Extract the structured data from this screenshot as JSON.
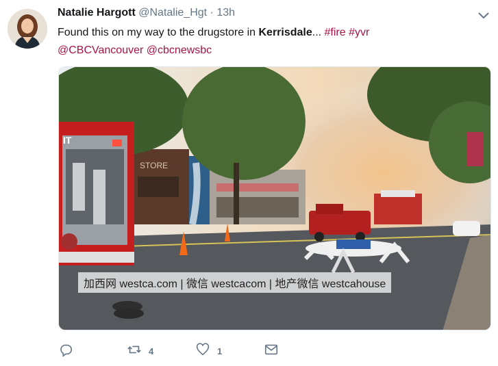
{
  "tweet": {
    "author_name": "Natalie Hargott",
    "author_handle": "@Natalie_Hgt",
    "separator": "·",
    "time": "13h",
    "text_before": "Found this on my way to the drugstore in ",
    "text_bold": "Kerrisdale",
    "text_ellipsis": "... ",
    "hashtags": [
      "#fire",
      "#yvr"
    ],
    "mentions": [
      "@CBCVancouver",
      "@cbcnewsbc"
    ]
  },
  "media": {
    "watermark": "加西网 westca.com | 微信 westcacom | 地产微信 westcahouse",
    "sign_truck": "IT",
    "sign_store": "STORE"
  },
  "actions": {
    "reply_count": "",
    "retweet_count": "4",
    "like_count": "1"
  },
  "icons": [
    "chevron-down-icon",
    "reply-icon",
    "retweet-icon",
    "like-icon",
    "message-icon"
  ],
  "colors": {
    "link": "#a81347",
    "muted": "#657786"
  }
}
